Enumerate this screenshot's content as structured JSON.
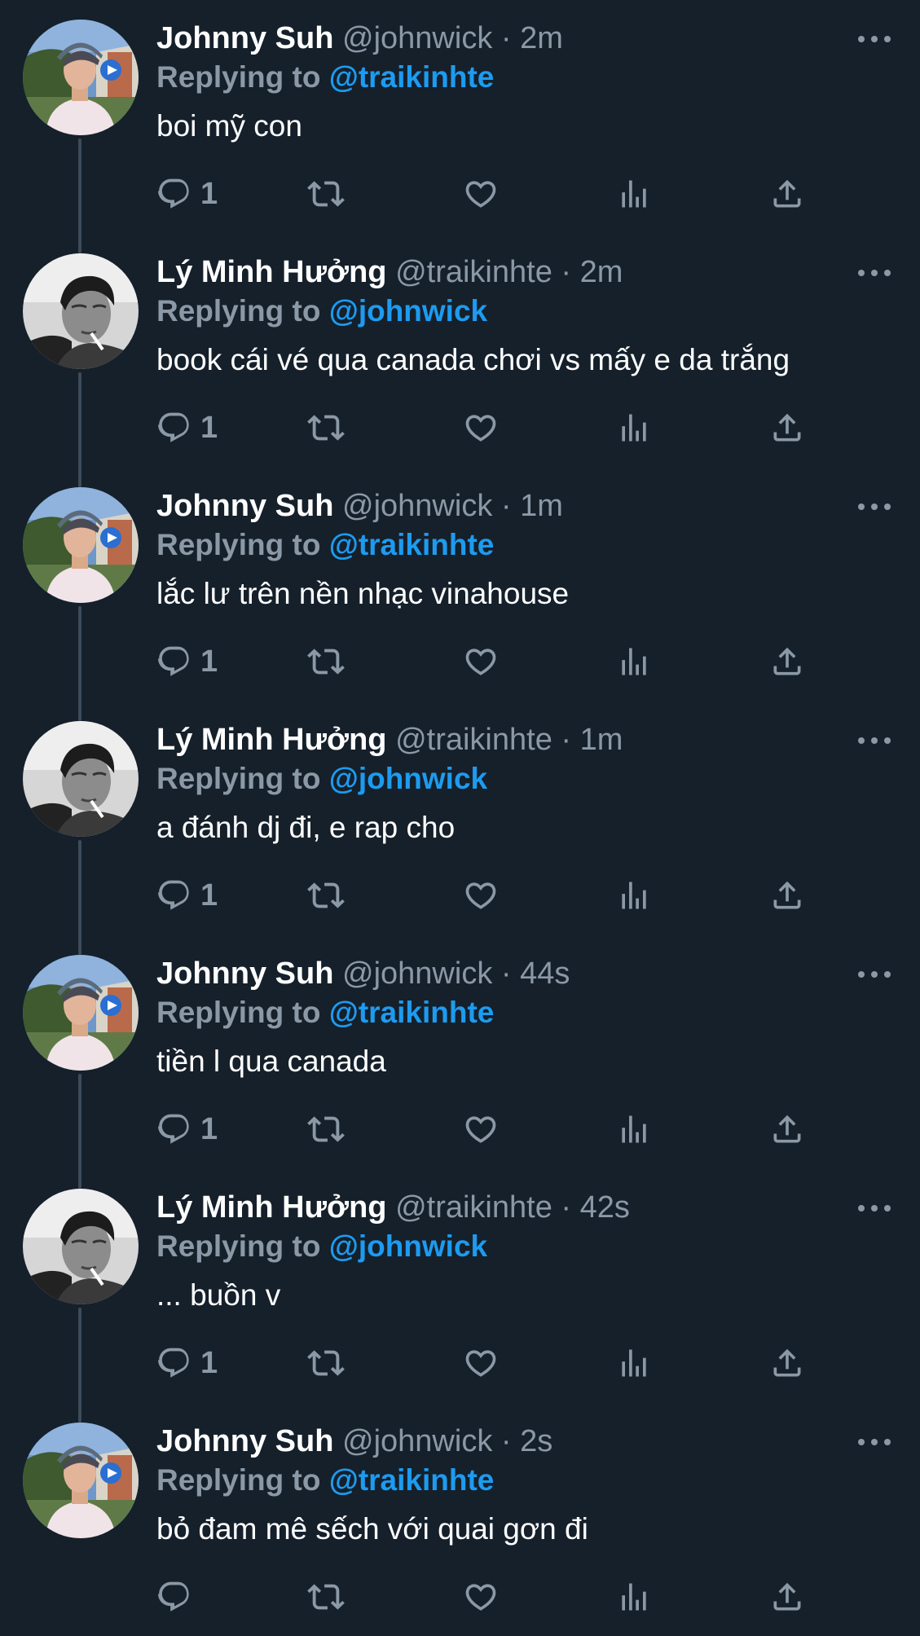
{
  "colors": {
    "background": "#15202b",
    "secondary_text": "#8b98a5",
    "accent": "#1d9bf0",
    "thread_line": "#3d4b59"
  },
  "icons": {
    "reply": "reply-icon",
    "retweet": "retweet-icon",
    "like": "heart-icon",
    "analytics": "analytics-icon",
    "share": "share-icon",
    "more": "more-icon"
  },
  "tweets": [
    {
      "avatar": "johnny",
      "name": "Johnny Suh",
      "handle": "@johnwick",
      "dot": "·",
      "time": "2m",
      "replying_prefix": "Replying to",
      "replying_handle": "@traikinhte",
      "text": "boi mỹ con",
      "reply_count": "1"
    },
    {
      "avatar": "ly",
      "name": "Lý Minh Hưởng",
      "handle": "@traikinhte",
      "dot": "·",
      "time": "2m",
      "replying_prefix": "Replying to",
      "replying_handle": "@johnwick",
      "text": "book cái vé qua canada chơi vs mấy e da trắng",
      "reply_count": "1"
    },
    {
      "avatar": "johnny",
      "name": "Johnny Suh",
      "handle": "@johnwick",
      "dot": "·",
      "time": "1m",
      "replying_prefix": "Replying to",
      "replying_handle": "@traikinhte",
      "text": "lắc lư trên nền nhạc vinahouse",
      "reply_count": "1"
    },
    {
      "avatar": "ly",
      "name": "Lý Minh Hưởng",
      "handle": "@traikinhte",
      "dot": "·",
      "time": "1m",
      "replying_prefix": "Replying to",
      "replying_handle": "@johnwick",
      "text": "a đánh dj đi, e rap cho",
      "reply_count": "1"
    },
    {
      "avatar": "johnny",
      "name": "Johnny Suh",
      "handle": "@johnwick",
      "dot": "·",
      "time": "44s",
      "replying_prefix": "Replying to",
      "replying_handle": "@traikinhte",
      "text": "tiền l qua canada",
      "reply_count": "1"
    },
    {
      "avatar": "ly",
      "name": "Lý Minh Hưởng",
      "handle": "@traikinhte",
      "dot": "·",
      "time": "42s",
      "replying_prefix": "Replying to",
      "replying_handle": "@johnwick",
      "text": "... buồn v",
      "reply_count": "1"
    },
    {
      "avatar": "johnny",
      "name": "Johnny Suh",
      "handle": "@johnwick",
      "dot": "·",
      "time": "2s",
      "replying_prefix": "Replying to",
      "replying_handle": "@traikinhte",
      "text": "bỏ đam mê sếch với quai gơn đi",
      "reply_count": ""
    }
  ]
}
